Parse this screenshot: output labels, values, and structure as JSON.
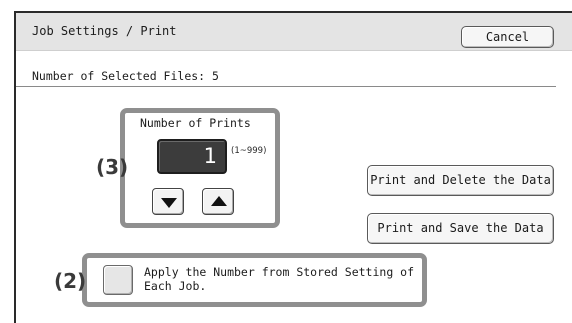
{
  "header": {
    "title": "Job Settings / Print",
    "cancel_label": "Cancel"
  },
  "summary": {
    "selected_files_text": "Number of Selected Files: 5"
  },
  "number_of_prints": {
    "label": "Number of Prints",
    "value": "1",
    "range_text": "(1~999)",
    "decrement_icon": "triangle-down-icon",
    "increment_icon": "triangle-up-icon"
  },
  "actions": {
    "print_delete_label": "Print and Delete the Data",
    "print_save_label": "Print and Save the Data"
  },
  "apply_option": {
    "checked": false,
    "label": "Apply the Number from Stored Setting of Each Job."
  },
  "callouts": {
    "number_of_prints_marker": "(3)",
    "apply_marker": "(2)"
  },
  "colors": {
    "highlight_border": "#8f8f8f",
    "display_bg": "#3c3c3c",
    "titlebar_bg": "#e4e4e4"
  }
}
